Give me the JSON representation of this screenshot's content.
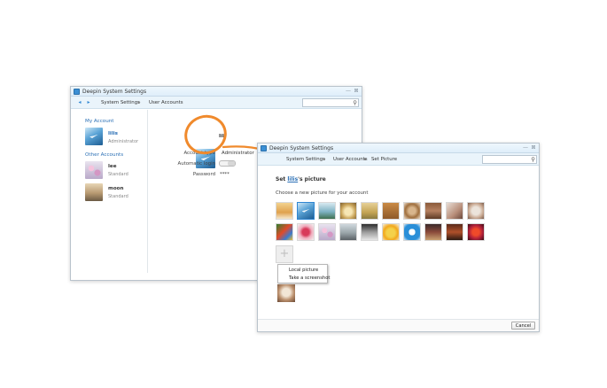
{
  "back_window": {
    "title": "Deepin System Settings",
    "breadcrumb": [
      "System Settings",
      "User Accounts"
    ],
    "my_account_heading": "My Account",
    "other_accounts_heading": "Other Accounts",
    "accounts": [
      {
        "name": "lilis",
        "type": "Administrator"
      },
      {
        "name": "lee",
        "type": "Standard"
      },
      {
        "name": "moon",
        "type": "Standard"
      }
    ],
    "detail": {
      "name_partial": "lil",
      "account_type_label": "Account type",
      "account_type_value": "Administrator",
      "auto_login_label": "Automatic login",
      "password_label": "Password",
      "password_value": "****"
    }
  },
  "front_window": {
    "title": "Deepin System Settings",
    "breadcrumb": [
      "System Settings",
      "User Accounts",
      "Set Picture"
    ],
    "set_title_prefix": "Set ",
    "set_title_user": "lilis",
    "set_title_suffix": "'s picture",
    "choose_label": "Choose a new picture for your account",
    "add_symbol": "+",
    "menu": [
      "Local picture",
      "Take a screenshot"
    ],
    "cancel_label": "Cancel"
  },
  "icons": {
    "back": "◂",
    "forward": "▸",
    "separator": "▸",
    "search": "⚲",
    "minimize": "—",
    "close": "⊠"
  },
  "colors": {
    "accent": "#2f86d2",
    "highlight": "#f08a2c"
  }
}
